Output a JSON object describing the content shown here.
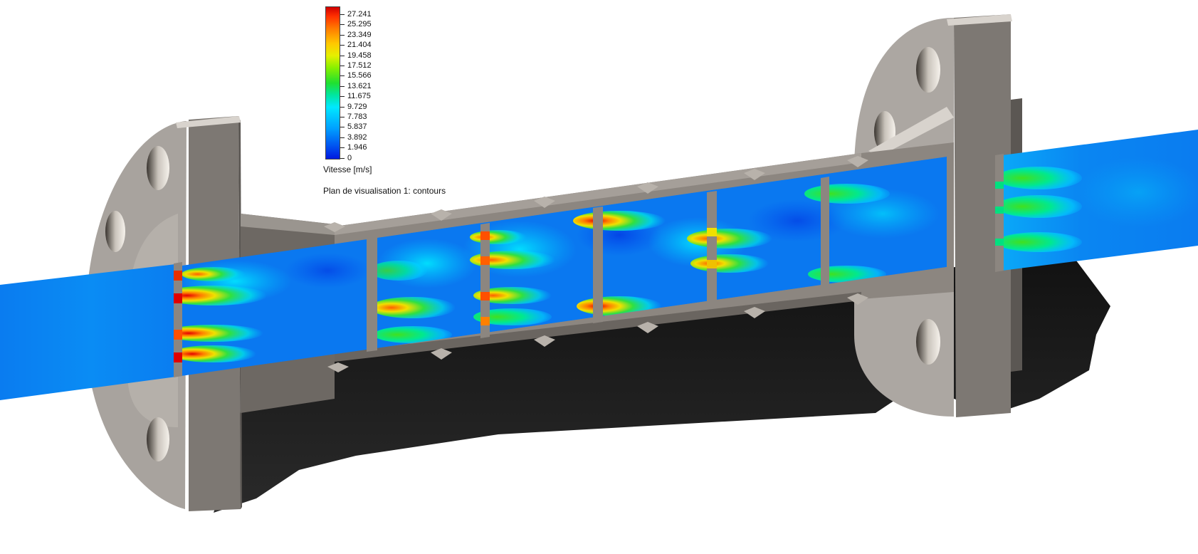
{
  "legend": {
    "ticks": [
      "27.241",
      "25.295",
      "23.349",
      "21.404",
      "19.458",
      "17.512",
      "15.566",
      "13.621",
      "11.675",
      "9.729",
      "7.783",
      "5.837",
      "3.892",
      "1.946",
      "0"
    ],
    "unit_label": "Vitesse [m/s]",
    "plane_label": "Plan de visualisation 1: contours"
  },
  "colors": {
    "low": "#0018e0",
    "mid_low": "#00e8ff",
    "mid": "#20e030",
    "mid_high": "#ffc800",
    "high": "#d00000",
    "metal": "#8c8680"
  }
}
